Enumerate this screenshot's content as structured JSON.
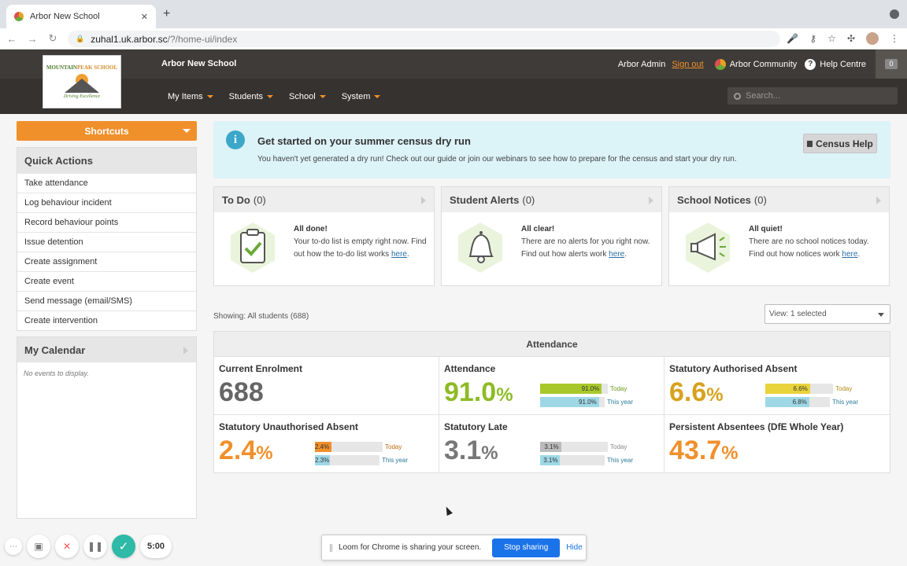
{
  "browser": {
    "tab_title": "Arbor New School",
    "url_host": "zuhal1.uk.arbor.sc",
    "url_path": "/?/home-ui/index",
    "new_tab_icon": "plus-icon"
  },
  "header": {
    "logo_title_a": "MOUNTAIN",
    "logo_title_b": "PEAK SCHOOL",
    "logo_subtitle": "Driving Excellence",
    "app_name": "Arbor New School",
    "admin_name": "Arbor Admin",
    "sign_out": "Sign out",
    "community": "Arbor Community",
    "help": "Help Centre",
    "message_count": "0",
    "search_placeholder": "Search...",
    "menu": [
      {
        "label": "My Items"
      },
      {
        "label": "Students"
      },
      {
        "label": "School"
      },
      {
        "label": "System"
      }
    ]
  },
  "sidebar": {
    "shortcuts": "Shortcuts",
    "quick_actions_title": "Quick Actions",
    "quick_actions": [
      "Take attendance",
      "Log behaviour incident",
      "Record behaviour points",
      "Issue detention",
      "Create assignment",
      "Create event",
      "Send message (email/SMS)",
      "Create intervention"
    ],
    "calendar_title": "My Calendar",
    "calendar_empty": "No events to display."
  },
  "banner": {
    "title": "Get started on your summer census dry run",
    "text": "You haven't yet generated a dry run! Check out our guide or join our webinars to see how to prepare for the census and start your dry run.",
    "button": "Census Help"
  },
  "cards": [
    {
      "title": "To Do",
      "count": "(0)",
      "heading": "All done!",
      "text": "Your to-do list is empty right now. Find out how the to-do list works ",
      "link": "here",
      "tail": "."
    },
    {
      "title": "Student Alerts",
      "count": "(0)",
      "heading": "All clear!",
      "text": "There are no alerts for you right now. Find out how alerts work ",
      "link": "here",
      "tail": "."
    },
    {
      "title": "School Notices",
      "count": "(0)",
      "heading": "All quiet!",
      "text": "There are no school notices today. Find out how notices work ",
      "link": "here",
      "tail": "."
    }
  ],
  "filters": {
    "showing": "Showing: All students (688)",
    "view": "View: 1 selected"
  },
  "attendance": {
    "title": "Attendance",
    "cells": [
      {
        "label": "Current Enrolment",
        "value": "688",
        "pct": "",
        "color": "#666666"
      },
      {
        "label": "Attendance",
        "value": "91.0",
        "pct": "%",
        "color": "#8dbb25",
        "today": {
          "text": "91.0%",
          "fraction": 0.91,
          "color": "#a8c82a",
          "label": "Today",
          "label_color": "#6a9a1a"
        },
        "year": {
          "text": "91.0%",
          "fraction": 0.91,
          "color": "#9ed8e6",
          "label": "This year",
          "label_color": "#2a7a9a"
        }
      },
      {
        "label": "Statutory Authorised Absent",
        "value": "6.6",
        "pct": "%",
        "color": "#d6a21e",
        "today": {
          "text": "6.6%",
          "fraction": 0.66,
          "color": "#e8d33a",
          "label": "Today",
          "label_color": "#b08a10"
        },
        "year": {
          "text": "6.8%",
          "fraction": 0.68,
          "color": "#9ed8e6",
          "label": "This year",
          "label_color": "#2a7a9a"
        }
      },
      {
        "label": "Statutory Unauthorised Absent",
        "value": "2.4",
        "pct": "%",
        "color": "#f0902b",
        "today": {
          "text": "2.4%",
          "fraction": 0.24,
          "color": "#f0902b",
          "label": "Today",
          "label_color": "#c06a10"
        },
        "year": {
          "text": "2.3%",
          "fraction": 0.23,
          "color": "#9ed8e6",
          "label": "This year",
          "label_color": "#2a7a9a"
        }
      },
      {
        "label": "Statutory Late",
        "value": "3.1",
        "pct": "%",
        "color": "#777777",
        "today": {
          "text": "3.1%",
          "fraction": 0.31,
          "color": "#bbbbbb",
          "label": "Today",
          "label_color": "#888888"
        },
        "year": {
          "text": "3.1%",
          "fraction": 0.31,
          "color": "#9ed8e6",
          "label": "This year",
          "label_color": "#2a7a9a"
        }
      },
      {
        "label": "Persistent Absentees (DfE Whole Year)",
        "value": "43.7",
        "pct": "%",
        "color": "#f0902b"
      }
    ]
  },
  "loom": {
    "text": "Loom for Chrome is sharing your screen.",
    "stop": "Stop sharing",
    "hide": "Hide"
  },
  "recorder": {
    "timer": "5:00"
  }
}
